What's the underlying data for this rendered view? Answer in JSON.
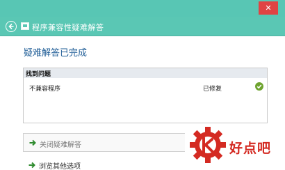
{
  "window": {
    "title": "程序兼容性疑难解答",
    "close_label": "✕"
  },
  "page": {
    "heading": "疑难解答已完成"
  },
  "problems": {
    "header": "找到问题",
    "rows": [
      {
        "name": "不兼容程序",
        "status": "已修复",
        "status_icon": "green-check-icon"
      }
    ]
  },
  "options": {
    "close_label": "关闭疑难解答",
    "more_label": "浏览其他选项"
  },
  "watermark": {
    "text": "好点吧"
  },
  "colors": {
    "titlebar": "#5ac7b4",
    "close_button": "#e04343",
    "heading": "#1e5c96",
    "check": "#6ea32f",
    "arrow": "#2e8b2e",
    "watermark": "#d42a22"
  }
}
